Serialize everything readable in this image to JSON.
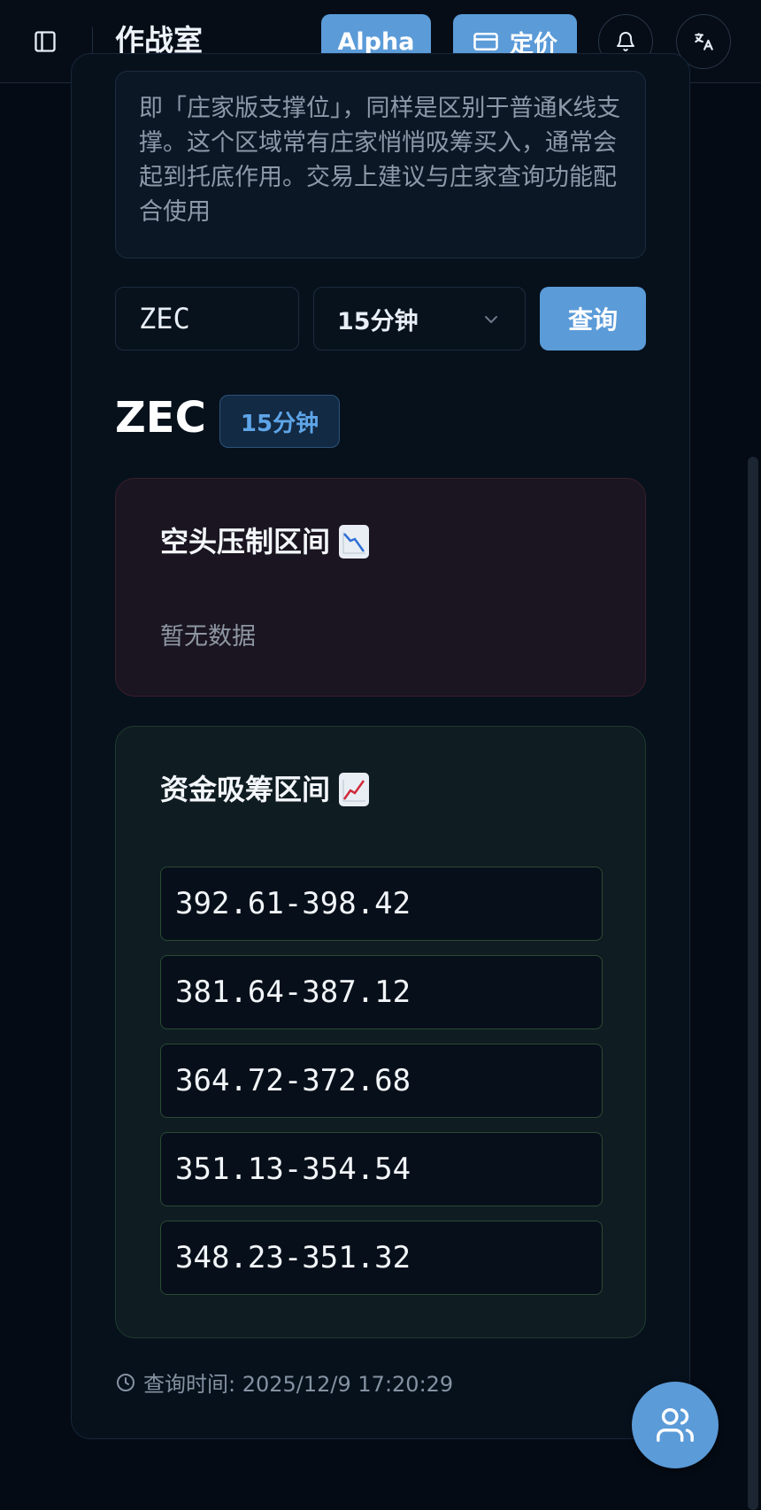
{
  "header": {
    "title": "作战室",
    "alpha_label": "Alpha",
    "pricing_label": "定价",
    "icons": [
      "sidebar-icon",
      "card-icon",
      "bell-icon",
      "translate-icon"
    ]
  },
  "description": {
    "text": "即「庄家版支撑位」，同样是区别于普通K线支撑。这个区域常有庄家悄悄吸筹买入，通常会起到托底作用。交易上建议与庄家查询功能配合使用"
  },
  "query_form": {
    "symbol_value": "ZEC",
    "interval_value": "15分钟",
    "submit_label": "查询"
  },
  "result": {
    "symbol": "ZEC",
    "interval": "15分钟",
    "short_zone": {
      "title": "空头压制区间",
      "icon": "chart-decreasing-icon",
      "empty_text": "暂无数据"
    },
    "long_zone": {
      "title": "资金吸筹区间",
      "icon": "chart-increasing-icon",
      "ranges": [
        "392.61-398.42",
        "381.64-387.12",
        "364.72-372.68",
        "351.13-354.54",
        "348.23-351.32"
      ]
    },
    "query_time": "查询时间: 2025/12/9 17:20:29"
  },
  "colors": {
    "accent": "#5b9bd8",
    "background": "#050b14",
    "short_zone_bg": "#1a1520",
    "long_zone_bg": "#0f1c22"
  }
}
